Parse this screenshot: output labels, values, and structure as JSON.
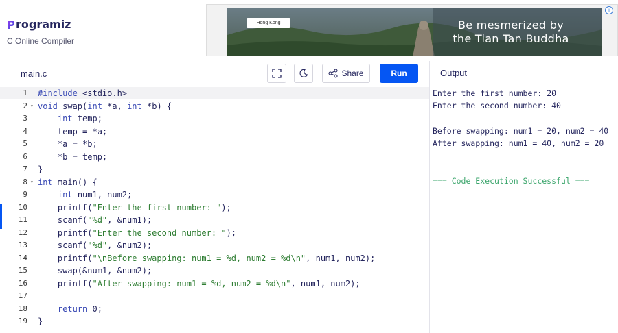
{
  "header": {
    "logo_text": "rogramiz",
    "subtitle": "C Online Compiler"
  },
  "ad": {
    "chip_text": "Hong Kong",
    "headline_line1": "Be mesmerized by",
    "headline_line2": "the Tian Tan Buddha",
    "info_icon": "info-icon"
  },
  "toolbar": {
    "file_tab": "main.c",
    "share_label": "Share",
    "run_label": "Run",
    "output_label": "Output"
  },
  "editor": {
    "lines": [
      {
        "n": "1",
        "fold": "",
        "code": "#include <stdio.h>"
      },
      {
        "n": "2",
        "fold": "▾",
        "code": "void swap(int *a, int *b) {"
      },
      {
        "n": "3",
        "fold": "",
        "code": "    int temp;"
      },
      {
        "n": "4",
        "fold": "",
        "code": "    temp = *a;"
      },
      {
        "n": "5",
        "fold": "",
        "code": "    *a = *b;"
      },
      {
        "n": "6",
        "fold": "",
        "code": "    *b = temp;"
      },
      {
        "n": "7",
        "fold": "",
        "code": "}"
      },
      {
        "n": "8",
        "fold": "▾",
        "code": "int main() {"
      },
      {
        "n": "9",
        "fold": "",
        "code": "    int num1, num2;"
      },
      {
        "n": "10",
        "fold": "",
        "code": "    printf(\"Enter the first number: \");"
      },
      {
        "n": "11",
        "fold": "",
        "code": "    scanf(\"%d\", &num1);"
      },
      {
        "n": "12",
        "fold": "",
        "code": "    printf(\"Enter the second number: \");"
      },
      {
        "n": "13",
        "fold": "",
        "code": "    scanf(\"%d\", &num2);"
      },
      {
        "n": "14",
        "fold": "",
        "code": "    printf(\"\\nBefore swapping: num1 = %d, num2 = %d\\n\", num1, num2);"
      },
      {
        "n": "15",
        "fold": "",
        "code": "    swap(&num1, &num2);"
      },
      {
        "n": "16",
        "fold": "",
        "code": "    printf(\"After swapping: num1 = %d, num2 = %d\\n\", num1, num2);"
      },
      {
        "n": "17",
        "fold": "",
        "code": ""
      },
      {
        "n": "18",
        "fold": "",
        "code": "    return 0;"
      },
      {
        "n": "19",
        "fold": "",
        "code": "}"
      }
    ]
  },
  "output": {
    "lines": [
      "Enter the first number: 20",
      "Enter the second number: 40",
      "",
      "Before swapping: num1 = 20, num2 = 40",
      "After swapping: num1 = 40, num2 = 20",
      "",
      "",
      "=== Code Execution Successful ==="
    ]
  },
  "colors": {
    "accent": "#0556f3",
    "brand": "#25265e",
    "success": "#3aa56b",
    "keyword": "#3b4bb5",
    "string": "#2e7d32"
  }
}
